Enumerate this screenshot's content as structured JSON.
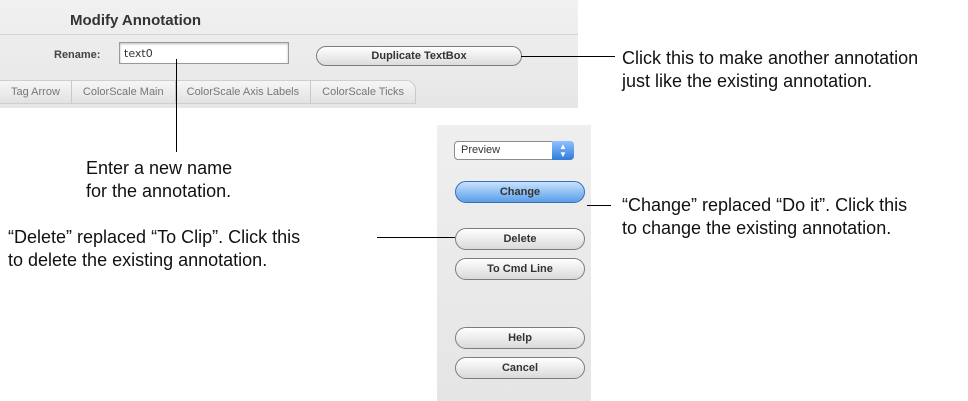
{
  "dialog": {
    "title": "Modify Annotation",
    "rename_label": "Rename:",
    "rename_value": "text0",
    "duplicate_button": "Duplicate TextBox",
    "tabs": [
      "Tag Arrow",
      "ColorScale Main",
      "ColorScale Axis Labels",
      "ColorScale Ticks"
    ]
  },
  "panel": {
    "mode_select": "Preview",
    "buttons": {
      "change": "Change",
      "delete": "Delete",
      "to_cmd_line": "To Cmd Line",
      "help": "Help",
      "cancel": "Cancel"
    }
  },
  "callouts": {
    "duplicate": [
      "Click this to make another annotation",
      "just like the existing annotation."
    ],
    "rename": [
      "Enter a new name",
      "for the annotation."
    ],
    "change": [
      "“Change” replaced “Do it”. Click this",
      "to change the existing annotation."
    ],
    "delete": [
      "“Delete” replaced “To Clip”. Click this",
      "to delete the existing annotation."
    ]
  },
  "colors": {
    "default_button": "#5a9ee8",
    "popup_arrow": "#2e7bd9"
  }
}
